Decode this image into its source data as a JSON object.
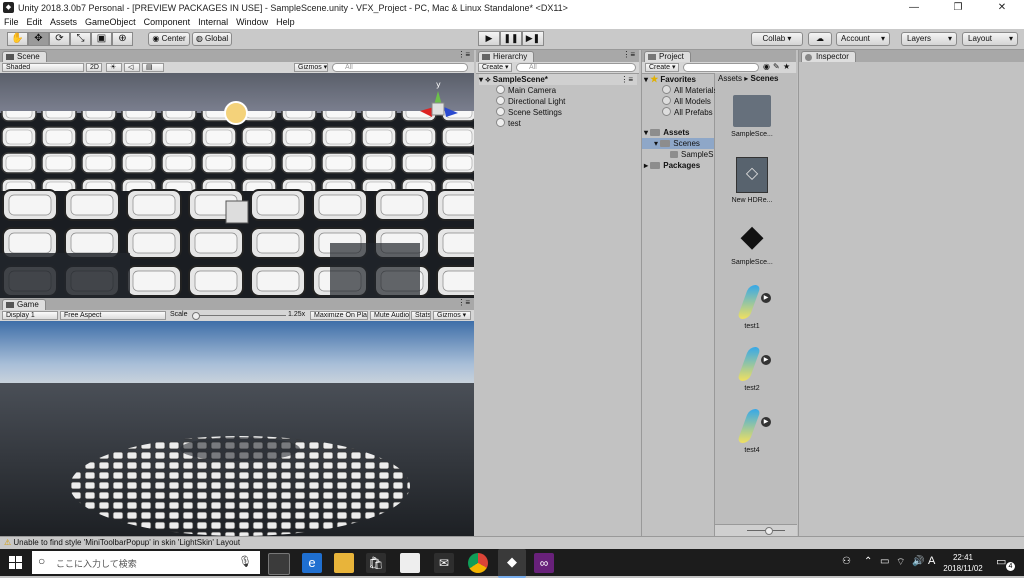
{
  "window": {
    "title": "Unity 2018.3.0b7 Personal - [PREVIEW PACKAGES IN USE] - SampleScene.unity - VFX_Project - PC, Mac & Linux Standalone* <DX11>"
  },
  "menu": [
    "File",
    "Edit",
    "Assets",
    "GameObject",
    "Component",
    "Internal",
    "Window",
    "Help"
  ],
  "toolbar": {
    "pivot": "Center",
    "space": "Global",
    "collab": "Collab ▾",
    "account": "Account",
    "layers": "Layers",
    "layout": "Layout"
  },
  "scene": {
    "tab": "Scene",
    "shading": "Shaded",
    "mode2d": "2D",
    "gizmos": "Gizmos ▾",
    "search_placeholder": "All",
    "axis_y": "y"
  },
  "game": {
    "tab": "Game",
    "display": "Display 1",
    "aspect": "Free Aspect",
    "scale_label": "Scale",
    "scale_value": "1.25x",
    "maximize": "Maximize On Play",
    "mute": "Mute Audio",
    "stats": "Stats",
    "gizmos": "Gizmos ▾"
  },
  "hierarchy": {
    "tab": "Hierarchy",
    "create": "Create ▾",
    "search_placeholder": "All",
    "scene": "SampleScene*",
    "items": [
      "Main Camera",
      "Directional Light",
      "Scene Settings",
      "test"
    ]
  },
  "project": {
    "tab": "Project",
    "create": "Create ▾",
    "favorites_label": "Favorites",
    "favorites": [
      "All Materials",
      "All Models",
      "All Prefabs"
    ],
    "assets_label": "Assets",
    "scenes_label": "Scenes",
    "scene_child": "SampleS",
    "packages_label": "Packages",
    "breadcrumb": [
      "Assets",
      "Scenes"
    ],
    "assets": [
      "SampleSce...",
      "New HDRe...",
      "SampleSce...",
      "test1",
      "test2",
      "test4"
    ]
  },
  "inspector": {
    "tab": "Inspector"
  },
  "status": {
    "message": "Unable to find style 'MiniToolbarPopup' in skin 'LightSkin' Layout"
  },
  "taskbar": {
    "search_placeholder": "ここに入力して検索",
    "time": "22:41",
    "date": "2018/11/02",
    "ime": "A",
    "notif_count": "4"
  },
  "colors": {
    "selected": "#3d7bd9",
    "accent_blue": "#36a8e8",
    "accent_yellow": "#f0e060"
  }
}
